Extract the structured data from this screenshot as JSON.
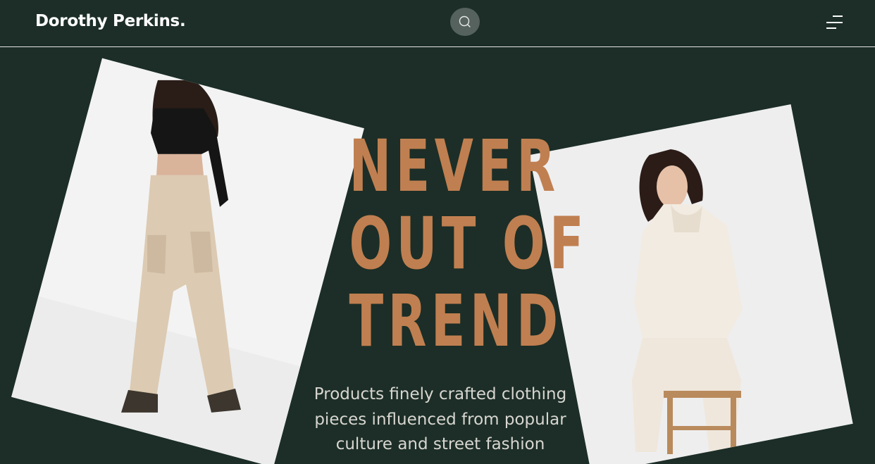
{
  "header": {
    "brand": "Dorothy Perkins.",
    "search_icon": "search-icon",
    "menu_icon": "hamburger-menu-icon"
  },
  "hero": {
    "headline_lines": [
      "NEVER",
      "OUT OF",
      "TREND"
    ],
    "tagline_lines": [
      "Products finely crafted clothing",
      "pieces influenced from popular",
      "culture and street fashion"
    ],
    "images": [
      "Model in black crop top and beige cargo pants with black boots",
      "Model in cream turtleneck sweater and pants seated on wooden stool"
    ]
  },
  "colors": {
    "background": "#1c2e27",
    "accent": "#c07f50",
    "text_light": "#ffffff",
    "tagline": "#d8d6d1"
  }
}
